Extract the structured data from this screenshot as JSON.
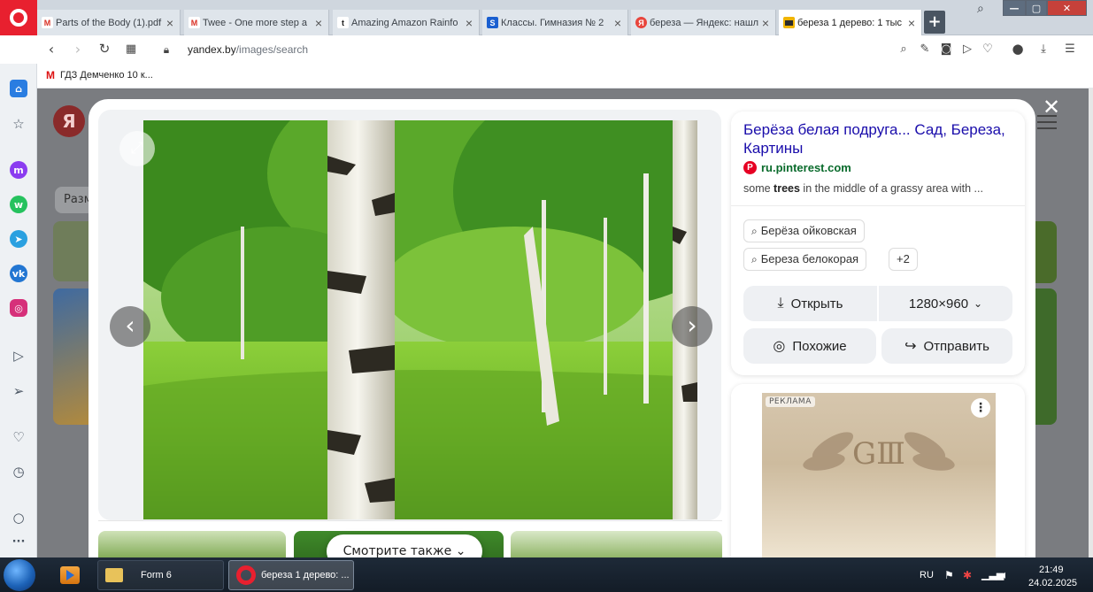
{
  "tabs": [
    {
      "label": "Parts of the Body (1).pdf",
      "fav": "M",
      "fav_color": "#ffffff",
      "fav_text": "#d93025"
    },
    {
      "label": "Twee - One more step a",
      "fav": "M",
      "fav_color": "#ffffff",
      "fav_text": "#d93025"
    },
    {
      "label": "Amazing Amazon Rainfo",
      "fav": "t",
      "fav_color": "#ffffff",
      "fav_text": "#1a1a1a"
    },
    {
      "label": "Классы. Гимназия № 2",
      "fav": "S",
      "fav_color": "#1a5fd0",
      "fav_text": "#ffffff"
    },
    {
      "label": "береза — Яндекс: нашл",
      "fav": "Я",
      "fav_color": "#e8453c",
      "fav_text": "#ffffff"
    },
    {
      "label": "береза 1 дерево: 1 тыс",
      "fav": "",
      "fav_color": "#f0b400",
      "fav_text": "#ffffff"
    }
  ],
  "address": {
    "host": "yandex.by",
    "path": "/images/search"
  },
  "bookmark": {
    "label": "ГДЗ Демченко 10 к..."
  },
  "viewer": {
    "see_also": "Смотрите также ⌄"
  },
  "info": {
    "title": "Берёза белая подруга... Сад, Береза, Картины",
    "source": "ru.pinterest.com",
    "desc_pre": "some ",
    "desc_bold": "trees",
    "desc_post": " in the middle of a grassy area with ...",
    "tags": [
      "Берёза ойковская",
      "Береза белокорая"
    ],
    "more_tags": "+2",
    "open_label": "Открыть",
    "size_label": "1280×960",
    "similar_label": "Похожие",
    "share_label": "Отправить"
  },
  "ad": {
    "badge": "РЕКЛАМА"
  },
  "page": {
    "chip": "Разм"
  },
  "taskbar": {
    "items": [
      {
        "label": "Form 6"
      },
      {
        "label": "береза 1 дерево: ..."
      }
    ],
    "lang": "RU",
    "time": "21:49",
    "date": "24.02.2025"
  }
}
